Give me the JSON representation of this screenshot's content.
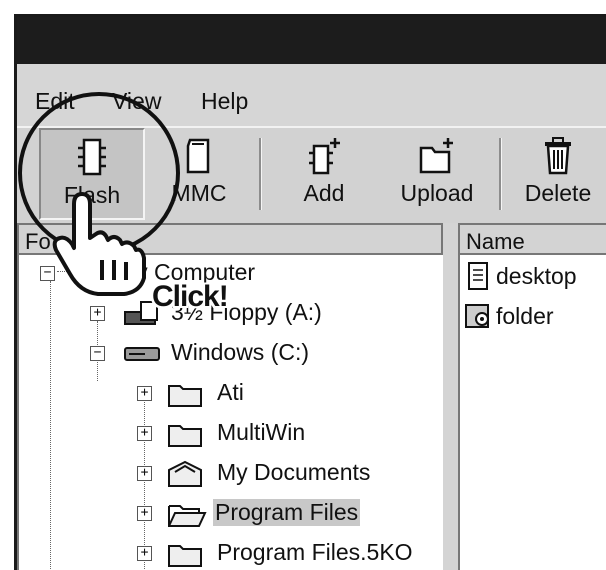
{
  "menu": {
    "edit": "Edit",
    "view": "View",
    "help": "Help"
  },
  "toolbar": {
    "flash": "Flash",
    "mmc": "MMC",
    "add": "Add",
    "upload": "Upload",
    "delete": "Delete"
  },
  "left_pane": {
    "header": "Fo",
    "items": [
      {
        "label": "My Computer",
        "icon": "computer-icon"
      },
      {
        "label": "3½ Floppy (A:)",
        "icon": "floppy-icon"
      },
      {
        "label": "Windows (C:)",
        "icon": "hard-drive-icon"
      },
      {
        "label": "Ati",
        "icon": "folder-icon"
      },
      {
        "label": "MultiWin",
        "icon": "folder-icon"
      },
      {
        "label": "My Documents",
        "icon": "documents-folder-icon"
      },
      {
        "label": "Program Files",
        "icon": "open-folder-icon",
        "selected": true
      },
      {
        "label": "Program Files.5KO",
        "icon": "folder-icon"
      }
    ]
  },
  "right_pane": {
    "header": "Name",
    "items": [
      {
        "label": "desktop",
        "icon": "text-file-icon"
      },
      {
        "label": "folder",
        "icon": "settings-file-icon"
      }
    ]
  },
  "annotation": {
    "click_label": "Click!"
  },
  "colors": {
    "titlebar": "#1c1c1c",
    "face": "#d4d4d4",
    "selection": "#c8c8c8"
  }
}
